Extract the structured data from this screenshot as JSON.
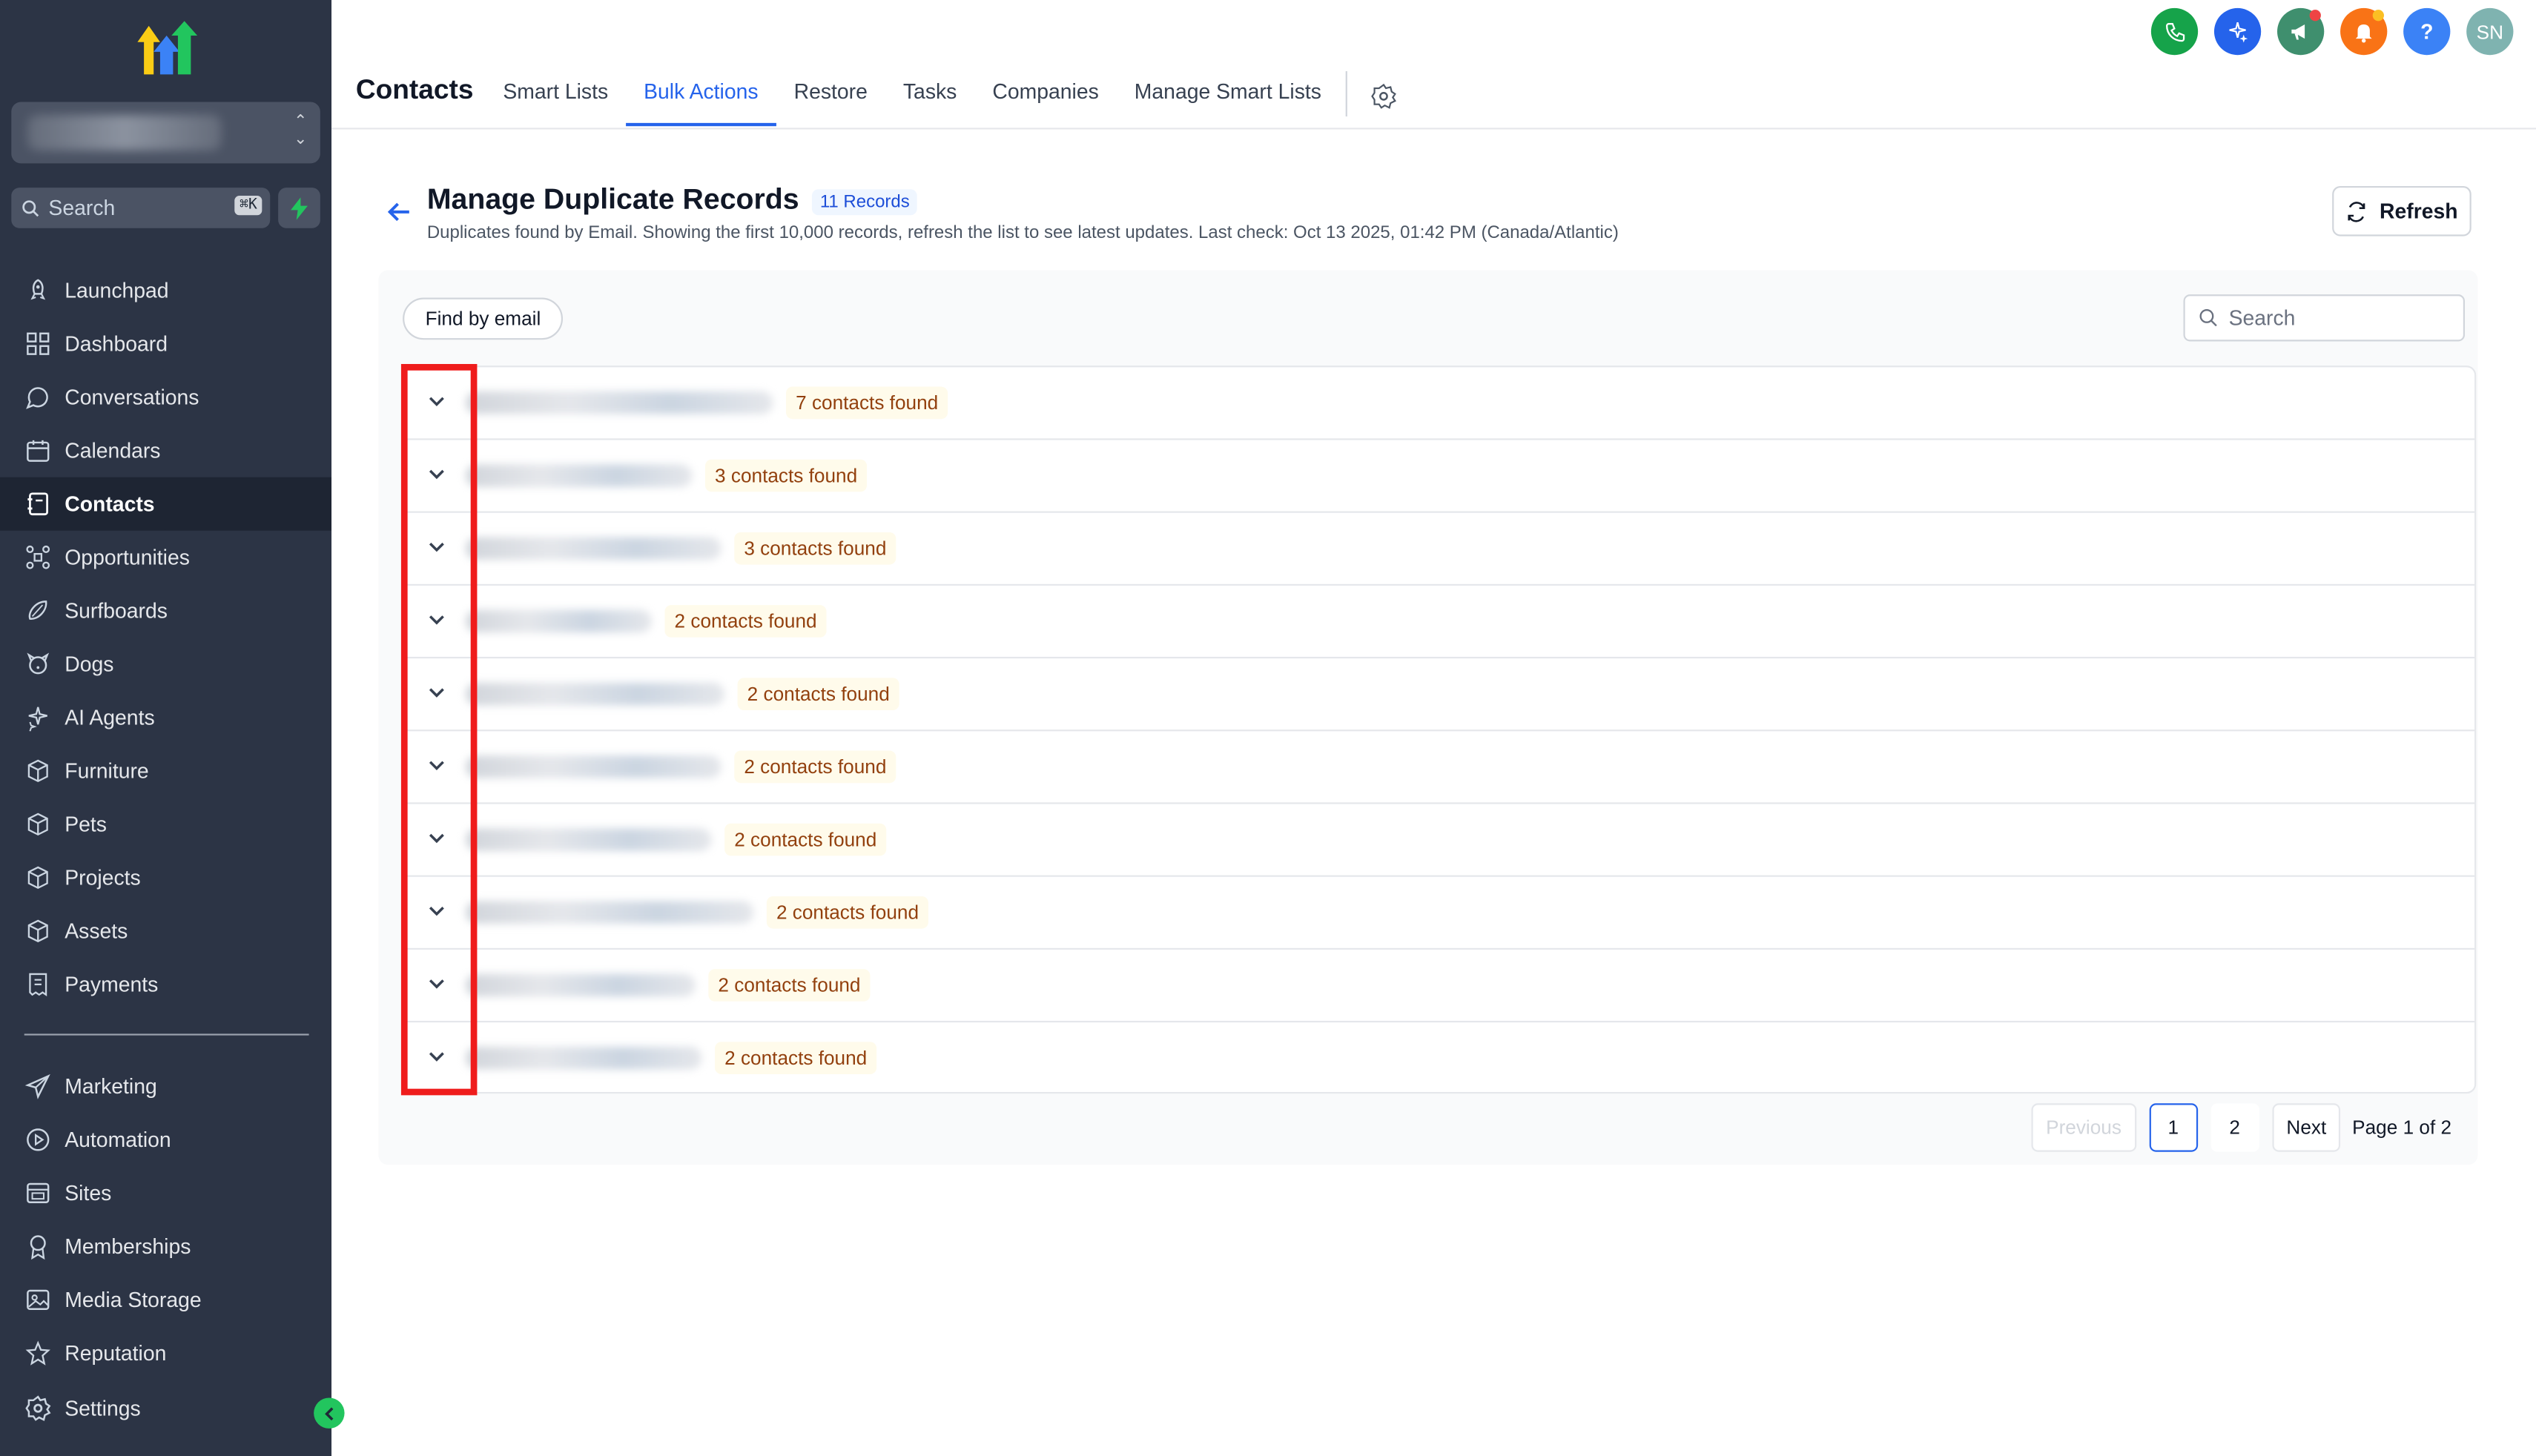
{
  "sidebar": {
    "search_placeholder": "Search",
    "search_shortcut": "⌘K",
    "items": [
      {
        "label": "Launchpad",
        "icon": "rocket-icon"
      },
      {
        "label": "Dashboard",
        "icon": "dashboard-grid-icon"
      },
      {
        "label": "Conversations",
        "icon": "chat-bubble-icon"
      },
      {
        "label": "Calendars",
        "icon": "calendar-icon"
      },
      {
        "label": "Contacts",
        "icon": "contacts-book-icon",
        "active": true
      },
      {
        "label": "Opportunities",
        "icon": "opportunities-network-icon"
      },
      {
        "label": "Surfboards",
        "icon": "surfboard-icon"
      },
      {
        "label": "Dogs",
        "icon": "dog-icon"
      },
      {
        "label": "AI Agents",
        "icon": "sparkles-icon"
      },
      {
        "label": "Furniture",
        "icon": "box-icon"
      },
      {
        "label": "Pets",
        "icon": "box-icon"
      },
      {
        "label": "Projects",
        "icon": "box-icon"
      },
      {
        "label": "Assets",
        "icon": "box-icon"
      },
      {
        "label": "Payments",
        "icon": "receipt-icon"
      }
    ],
    "items2": [
      {
        "label": "Marketing",
        "icon": "paper-plane-icon"
      },
      {
        "label": "Automation",
        "icon": "automation-icon"
      },
      {
        "label": "Sites",
        "icon": "sites-icon"
      },
      {
        "label": "Memberships",
        "icon": "award-icon"
      },
      {
        "label": "Media Storage",
        "icon": "image-icon"
      },
      {
        "label": "Reputation",
        "icon": "star-icon"
      }
    ],
    "settings_label": "Settings"
  },
  "header": {
    "title": "Contacts",
    "tabs": [
      "Smart Lists",
      "Bulk Actions",
      "Restore",
      "Tasks",
      "Companies",
      "Manage Smart Lists"
    ],
    "active_tab": "Bulk Actions",
    "avatar_initials": "SN",
    "help_label": "?"
  },
  "page": {
    "title": "Manage Duplicate Records",
    "records_badge": "11 Records",
    "subtitle": "Duplicates found by Email. Showing the first 10,000 records, refresh the list to see latest updates. Last check: Oct 13 2025, 01:42 PM (Canada/Atlantic)",
    "refresh_label": "Refresh",
    "find_button": "Find by email",
    "search_placeholder": "Search"
  },
  "duplicates": [
    {
      "count_label": "7 contacts found"
    },
    {
      "count_label": "3 contacts found"
    },
    {
      "count_label": "3 contacts found"
    },
    {
      "count_label": "2 contacts found"
    },
    {
      "count_label": "2 contacts found"
    },
    {
      "count_label": "2 contacts found"
    },
    {
      "count_label": "2 contacts found"
    },
    {
      "count_label": "2 contacts found"
    },
    {
      "count_label": "2 contacts found"
    },
    {
      "count_label": "2 contacts found"
    }
  ],
  "pagination": {
    "previous": "Previous",
    "pages": [
      "1",
      "2"
    ],
    "current": "1",
    "next": "Next",
    "info": "Page 1 of 2"
  },
  "colors": {
    "sidebar_bg": "#2c3445",
    "accent": "#2563eb",
    "highlight": "#ef1c1c",
    "count_text": "#92400e"
  }
}
